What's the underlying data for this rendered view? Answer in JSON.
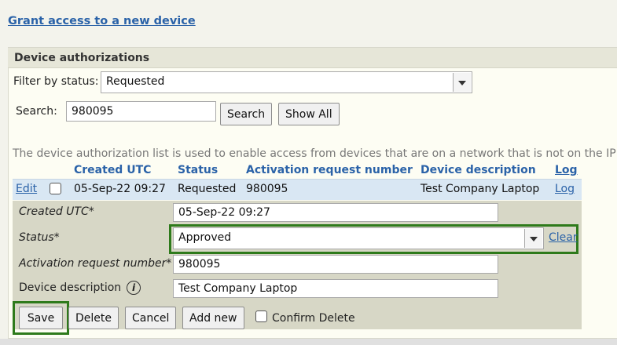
{
  "links": {
    "grant_access": "Grant access to a new device"
  },
  "panel": {
    "title": "Device authorizations"
  },
  "filter": {
    "label": "Filter by status:",
    "value": "Requested"
  },
  "search": {
    "label": "Search:",
    "value": "980095",
    "search_button": "Search",
    "show_all_button": "Show All"
  },
  "info_text": "The device authorization list is used to enable access from devices that are on a network that is not on the IP",
  "grid": {
    "columns": [
      "Created UTC",
      "Status",
      "Activation request number",
      "Device description",
      "Log"
    ],
    "row": {
      "edit": "Edit",
      "created_utc": "05-Sep-22 09:27",
      "status": "Requested",
      "activation_request_number": "980095",
      "device_description": "Test Company Laptop",
      "log": "Log"
    }
  },
  "form": {
    "created_label": "Created UTC*",
    "created_value": "05-Sep-22 09:27",
    "status_label": "Status*",
    "status_value": "Approved",
    "clear": "Clear",
    "arn_label": "Activation request number*",
    "arn_value": "980095",
    "desc_label": "Device description",
    "desc_value": "Test Company Laptop",
    "info_icon_glyph": "i"
  },
  "buttons": {
    "save": "Save",
    "delete": "Delete",
    "cancel": "Cancel",
    "add_new": "Add new",
    "confirm_delete": "Confirm Delete"
  },
  "colors": {
    "link": "#2a62a8",
    "highlight": "#2e7a1b",
    "row_bg": "#d9e7f3",
    "form_bg": "#d7d7c6"
  }
}
